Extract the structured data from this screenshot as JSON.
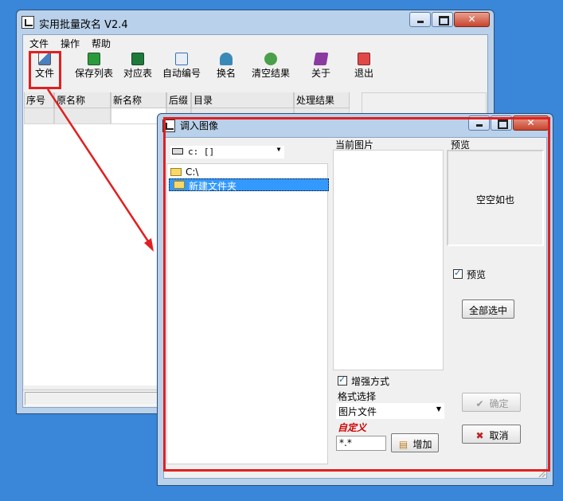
{
  "main_window": {
    "title": "实用批量改名 V2.4",
    "menu": [
      "文件",
      "操作",
      "帮助"
    ],
    "toolbar": [
      {
        "label": "文件",
        "icon": "open-file-icon",
        "color": "#4a7fc0"
      },
      {
        "label": "保存列表",
        "icon": "save-list-icon",
        "color": "#2c9a3c"
      },
      {
        "label": "对应表",
        "icon": "excel-icon",
        "color": "#1f7a3a"
      },
      {
        "label": "自动编号",
        "icon": "ab-numbering-icon",
        "color": "#3a6fb0"
      },
      {
        "label": "换名",
        "icon": "hammer-icon",
        "color": "#3a8ab8"
      },
      {
        "label": "清空结果",
        "icon": "recycle-icon",
        "color": "#4aa04a"
      },
      {
        "label": "关于",
        "icon": "book-icon",
        "color": "#8a3aa0"
      },
      {
        "label": "退出",
        "icon": "exit-icon",
        "color": "#e04848"
      }
    ],
    "columns": [
      "序号",
      "原名称",
      "新名称",
      "后缀",
      "目录",
      "处理结果"
    ]
  },
  "dialog": {
    "title": "调入图像",
    "drive": "c: []",
    "folders": [
      "C:\\",
      "新建文件夹"
    ],
    "current_images_label": "当前图片",
    "preview_label": "预览",
    "preview_empty": "空空如也",
    "preview_checkbox": "预览",
    "enhance_checkbox": "增强方式",
    "format_label": "格式选择",
    "format_value": "图片文件",
    "custom_label": "自定义",
    "ext_value": "*.*",
    "add_button": "增加",
    "select_all_button": "全部选中",
    "ok_button": "确定",
    "cancel_button": "取消"
  },
  "colors": {
    "annotation": "#e02020",
    "selection": "#3399ff",
    "desktop": "#3a86d8"
  }
}
